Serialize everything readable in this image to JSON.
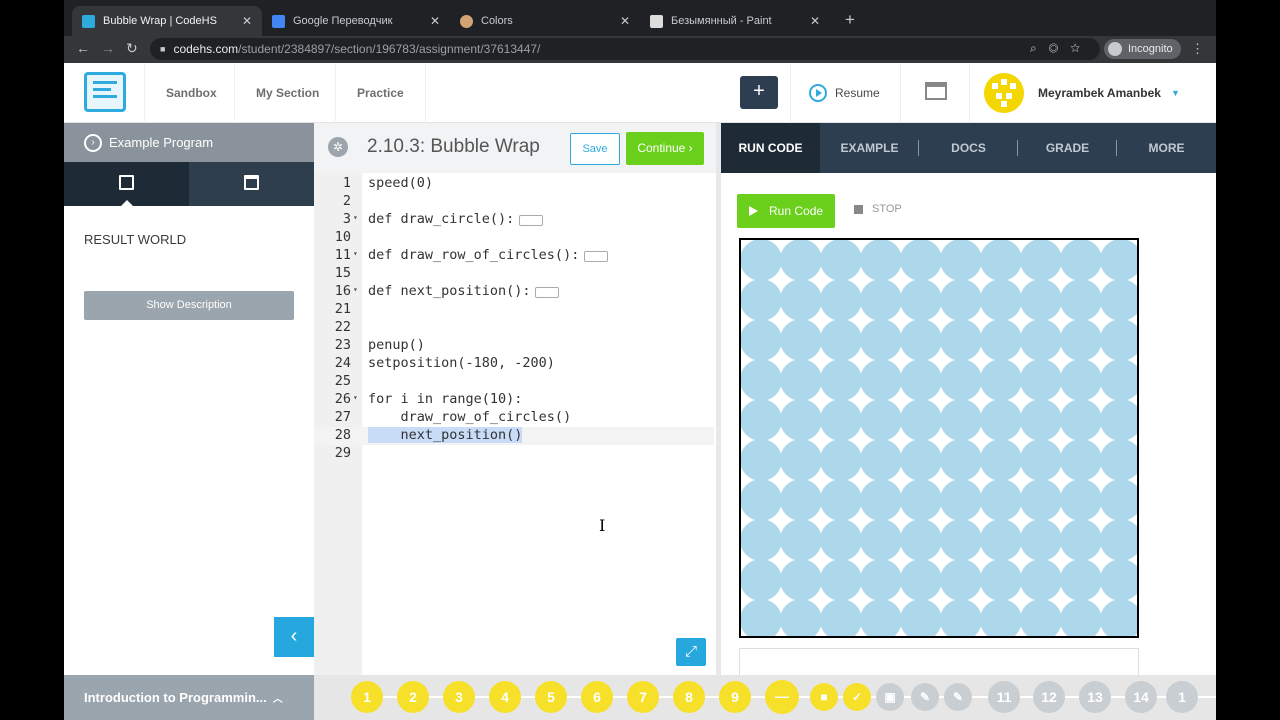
{
  "browser": {
    "tabs": [
      {
        "title": "Bubble Wrap | CodeHS",
        "active": true,
        "favicon_color": "#2eaadc"
      },
      {
        "title": "Google Переводчик",
        "active": false,
        "favicon_color": "#4285f4"
      },
      {
        "title": "Colors",
        "active": false,
        "favicon_color": "#d4a373"
      },
      {
        "title": "Безымянный - Paint",
        "active": false,
        "favicon_color": "#dddddd"
      }
    ],
    "url_host": "codehs.com",
    "url_path": "/student/2384897/section/196783/assignment/37613447/",
    "incognito_label": "Incognito"
  },
  "site_nav": {
    "items": [
      "Sandbox",
      "My Section",
      "Practice"
    ],
    "plus_label": "+",
    "resume_label": "Resume",
    "user_name": "Meyrambek Amanbek"
  },
  "left_panel": {
    "header": "Example Program",
    "result_label": "RESULT WORLD",
    "show_description": "Show Description",
    "collapse_glyph": "‹"
  },
  "editor": {
    "title": "2.10.3: Bubble Wrap",
    "save_label": "Save",
    "continue_label": "Continue ›",
    "lines": [
      {
        "num": "1",
        "text": "speed(0)"
      },
      {
        "num": "2",
        "text": ""
      },
      {
        "num": "3",
        "text": "def draw_circle():"
      },
      {
        "num": "10",
        "text": ""
      },
      {
        "num": "11",
        "text": "def draw_row_of_circles():"
      },
      {
        "num": "15",
        "text": ""
      },
      {
        "num": "16",
        "text": "def next_position():"
      },
      {
        "num": "21",
        "text": ""
      },
      {
        "num": "22",
        "text": ""
      },
      {
        "num": "23",
        "text": "penup()"
      },
      {
        "num": "24",
        "text": "setposition(-180, -200)"
      },
      {
        "num": "25",
        "text": ""
      },
      {
        "num": "26",
        "text": "for i in range(10):"
      },
      {
        "num": "27",
        "text": "    draw_row_of_circles()"
      },
      {
        "num": "28",
        "text": "    next_position()"
      },
      {
        "num": "29",
        "text": ""
      }
    ]
  },
  "right_panel": {
    "tabs": [
      "RUN CODE",
      "EXAMPLE",
      "DOCS",
      "GRADE",
      "MORE"
    ],
    "run_label": "Run Code",
    "stop_label": "STOP",
    "circle_color": "#add8eb",
    "grid_rows": 10,
    "grid_cols": 10
  },
  "bottom_bar": {
    "course_title": "Introduction to Programmin...",
    "steps": [
      "1",
      "2",
      "3",
      "4",
      "5",
      "6",
      "7",
      "8",
      "9",
      "—",
      "■",
      "✓",
      "▣",
      "✎",
      "✎",
      "11",
      "12",
      "13",
      "14",
      "1"
    ]
  }
}
